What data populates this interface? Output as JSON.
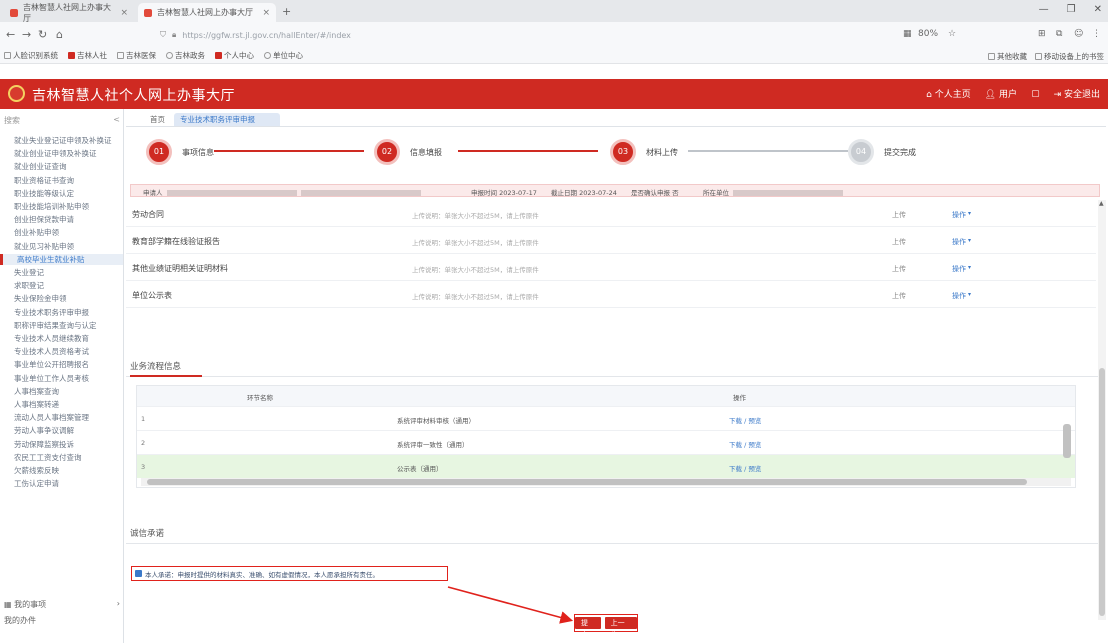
{
  "browser": {
    "tabs": [
      {
        "title": "吉林智慧人社网上办事大厅",
        "active": false
      },
      {
        "title": "吉林智慧人社网上办事大厅",
        "active": true
      }
    ],
    "new_tab": "+",
    "url": "https://ggfw.rst.jl.gov.cn/hallEnter/#/index",
    "zoom": "80%",
    "bookmarks": [
      "人脸识别系统",
      "吉林人社",
      "吉林医保",
      "吉林政务",
      "个人中心",
      "单位中心"
    ],
    "bookmarks_right": [
      "其他收藏",
      "移动设备上的书签"
    ],
    "window_controls": [
      "—",
      "❐",
      "✕"
    ]
  },
  "header": {
    "title": "吉林智慧人社个人网上办事大厅",
    "actions": [
      "个人主页",
      "用户",
      "消息",
      "安全退出"
    ]
  },
  "sidebar": {
    "search_placeholder": "搜索",
    "collapse": "<",
    "items": [
      "就业失业登记证申领及补换证",
      "就业创业证申领及补换证",
      "就业创业证查询",
      "职业资格证书查询",
      "职业技能等级认定",
      "职业技能培训补贴申领",
      "创业担保贷款申请",
      "创业补贴申领",
      "就业见习补贴申领",
      "高校毕业生就业补贴",
      "失业登记",
      "求职登记",
      "失业保险金申领",
      "专业技术职务评审申报",
      "职称评审结果查询与认定",
      "专业技术人员继续教育",
      "专业技术人员资格考试",
      "事业单位公开招聘报名",
      "事业单位工作人员考核",
      "人事档案查询",
      "人事档案转递",
      "流动人员人事档案管理",
      "劳动人事争议调解",
      "劳动保障监察投诉",
      "农民工工资支付查询",
      "欠薪线索反映",
      "工伤认定申请"
    ],
    "active_index": 9,
    "footer": [
      "我的事项",
      "我的办件"
    ],
    "footer_arrow": "›"
  },
  "main": {
    "tabs": [
      "首页",
      "专业技术职务评审申报"
    ],
    "steps": [
      {
        "num": "01",
        "label": "事项信息",
        "done": true
      },
      {
        "num": "02",
        "label": "信息填报",
        "done": true
      },
      {
        "num": "03",
        "label": "材料上传",
        "done": true
      },
      {
        "num": "04",
        "label": "提交完成",
        "done": false
      }
    ],
    "info": {
      "applicant_label": "申请人",
      "apply_date_label": "申报时间",
      "apply_date": "2023-07-17",
      "deadline_label": "截止日期",
      "deadline": "2023-07-24",
      "status_label": "是否确认申报",
      "status": "否",
      "unit_label": "所在单位"
    },
    "materials": [
      {
        "name": "劳动合同",
        "hint": "上传说明：单张大小不超过5M，请上传原件",
        "upload": "上传",
        "op": "操作"
      },
      {
        "name": "教育部学籍在线验证报告",
        "hint": "上传说明：单张大小不超过5M，请上传原件",
        "upload": "上传",
        "op": "操作"
      },
      {
        "name": "其他业绩证明相关证明材料",
        "hint": "上传说明：单张大小不超过5M，请上传原件",
        "upload": "上传",
        "op": "操作"
      },
      {
        "name": "单位公示表",
        "hint": "上传说明：单张大小不超过5M，请上传原件",
        "upload": "上传",
        "op": "操作"
      }
    ],
    "progress_section": "业务流程信息",
    "progress_table": {
      "headers": [
        "环节名称",
        "操作"
      ],
      "rows": [
        {
          "num": "1",
          "node": "系统评审材料审核（通用）",
          "op": "下载 / 预览"
        },
        {
          "num": "2",
          "node": "系统评审一致性（通用）",
          "op": "下载 / 预览"
        },
        {
          "num": "3",
          "node": "公示表（通用）",
          "op": "下载 / 预览"
        }
      ]
    },
    "commitment_section": "诚信承诺",
    "commitment_text": "本人承诺：申报时提供的材料真实、准确、如有虚假情况，本人愿承担所有责任。",
    "buttons": {
      "submit": "提交",
      "prev": "上一步"
    }
  },
  "colors": {
    "brand_red": "#cf2a22",
    "highlight_red": "#e0221c",
    "link_blue": "#3b79c9",
    "row_green": "#e7f6e1"
  }
}
